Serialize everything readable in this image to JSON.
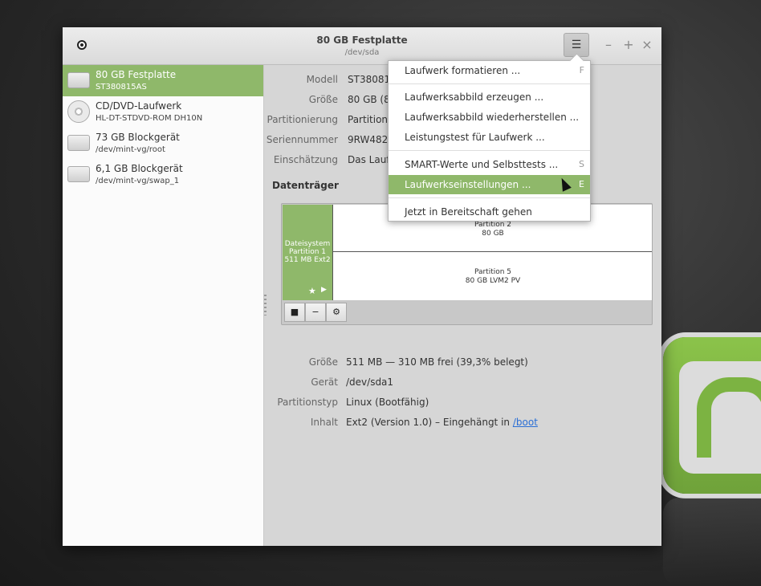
{
  "window": {
    "title": "80 GB Festplatte",
    "subtitle": "/dev/sda"
  },
  "titlebar_buttons": {
    "menu": "☰",
    "minimize": "–",
    "maximize": "+",
    "close": "×"
  },
  "sidebar": {
    "items": [
      {
        "name": "80 GB Festplatte",
        "detail": "ST380815AS"
      },
      {
        "name": "CD/DVD-Laufwerk",
        "detail": "HL-DT-STDVD-ROM DH10N"
      },
      {
        "name": "73 GB Blockgerät",
        "detail": "/dev/mint-vg/root"
      },
      {
        "name": "6,1 GB Blockgerät",
        "detail": "/dev/mint-vg/swap_1"
      }
    ]
  },
  "drive_props": [
    {
      "label": "Modell",
      "value": "ST38081"
    },
    {
      "label": "Größe",
      "value": "80 GB (8"
    },
    {
      "label": "Partitionierung",
      "value": "Partitions"
    },
    {
      "label": "Seriennummer",
      "value": "9RW482H"
    },
    {
      "label": "Einschätzung",
      "value": "Das Lauf"
    }
  ],
  "volumes_title": "Datenträger",
  "partitions": {
    "p1": [
      "Dateisystem",
      "Partition 1",
      "511 MB Ext2"
    ],
    "p2": [
      "Partition 2",
      "80 GB"
    ],
    "p5": [
      "Partition 5",
      "80 GB LVM2 PV"
    ],
    "p1_icons": {
      "star": "★",
      "play": "▶"
    }
  },
  "toolbar": {
    "stop": "■",
    "minus": "−",
    "gear": "⚙"
  },
  "partition_props": [
    {
      "label": "Größe",
      "value": "511 MB — 310 MB frei (39,3% belegt)"
    },
    {
      "label": "Gerät",
      "value": "/dev/sda1"
    },
    {
      "label": "Partitionstyp",
      "value": "Linux (Bootfähig)"
    },
    {
      "label": "Inhalt",
      "value": "Ext2 (Version 1.0) – Eingehängt in ",
      "link": "/boot"
    }
  ],
  "menu": {
    "items": [
      {
        "label": "Laufwerk formatieren ...",
        "key": "F"
      },
      {
        "label": "Laufwerksabbild erzeugen ...",
        "key": ""
      },
      {
        "label": "Laufwerksabbild wiederherstellen ...",
        "key": ""
      },
      {
        "label": "Leistungstest für Laufwerk ...",
        "key": ""
      },
      {
        "label": "SMART-Werte und Selbsttests ...",
        "key": "S"
      },
      {
        "label": "Laufwerkseinstellungen ...",
        "key": "E"
      },
      {
        "label": "Jetzt in Bereitschaft gehen",
        "key": ""
      }
    ]
  },
  "colors": {
    "accent": "#8fb86a",
    "link": "#2a6fd6"
  }
}
